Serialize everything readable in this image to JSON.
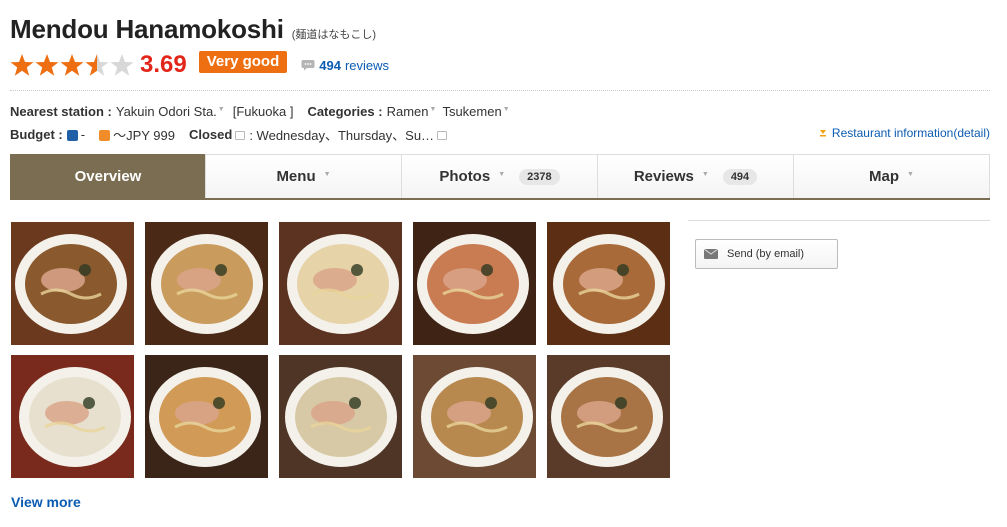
{
  "restaurant": {
    "name": "Mendou Hanamokoshi",
    "kana": "(麺道はなもこし)",
    "score": "3.69",
    "stars": 3.5,
    "rating_badge": "Very good",
    "review_count": "494",
    "reviews_suffix": "reviews"
  },
  "info": {
    "station_label": "Nearest station :",
    "station_value": "Yakuin Odori Sta.",
    "station_area": "[Fukuoka ]",
    "categories_label": "Categories :",
    "categories": [
      "Ramen",
      "Tsukemen"
    ],
    "budget_label": "Budget :",
    "budget_dinner": "-",
    "budget_lunch": "～JPY 999",
    "closed_label": "Closed",
    "closed_value": ": Wednesday、Thursday、Su…",
    "detail_link": "Restaurant information(detail)"
  },
  "tabs": [
    {
      "label": "Overview",
      "active": true
    },
    {
      "label": "Menu"
    },
    {
      "label": "Photos",
      "count": "2378"
    },
    {
      "label": "Reviews",
      "count": "494"
    },
    {
      "label": "Map"
    }
  ],
  "photos": [
    {
      "icon": "ramen-photo"
    },
    {
      "icon": "ramen-photo"
    },
    {
      "icon": "ramen-photo"
    },
    {
      "icon": "ramen-photo"
    },
    {
      "icon": "ramen-photo"
    },
    {
      "icon": "ramen-photo"
    },
    {
      "icon": "ramen-photo"
    },
    {
      "icon": "ramen-photo"
    },
    {
      "icon": "ramen-photo"
    },
    {
      "icon": "ramen-photo"
    }
  ],
  "view_more": "View more",
  "send_button": "Send (by email)",
  "colors": {
    "score": "#e2261a",
    "badge": "#ee6f12",
    "link": "#0b5cb1",
    "active_tab": "#7a6d51",
    "star": "#ee6f12"
  }
}
